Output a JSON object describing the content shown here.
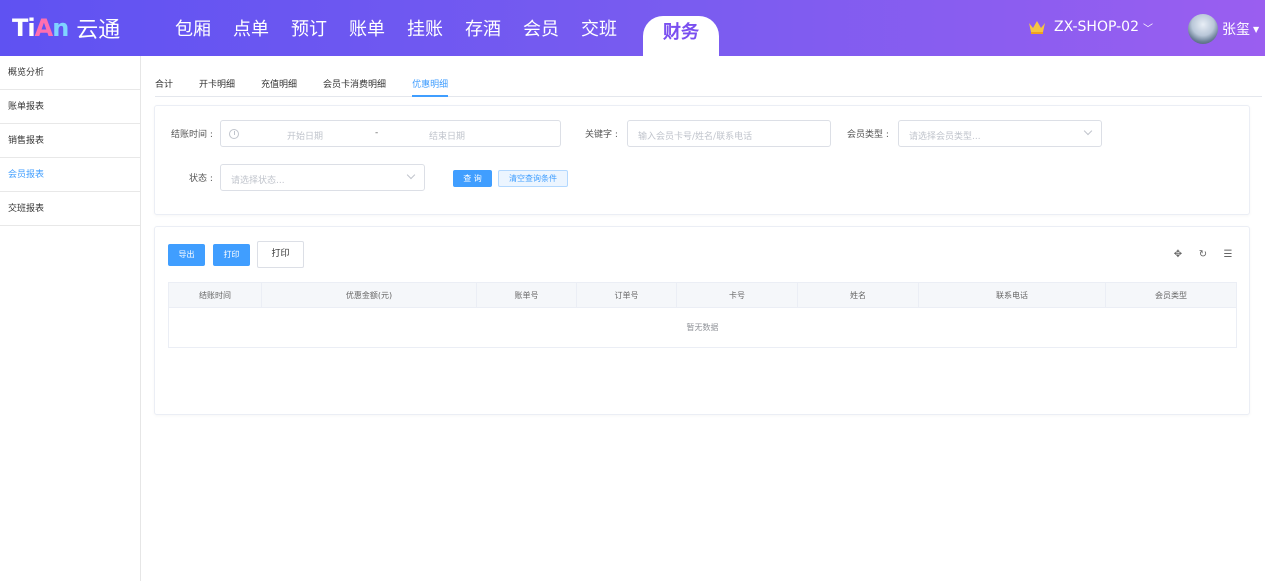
{
  "header": {
    "logo_letters": [
      "Ti",
      "A",
      "n"
    ],
    "logo_text": "云通",
    "nav": [
      "包厢",
      "点单",
      "预订",
      "账单",
      "挂账",
      "存酒",
      "会员",
      "交班",
      "财务"
    ],
    "active_nav": "财务",
    "shop": "ZX-SHOP-02",
    "user": "张玺",
    "colors": {
      "header_start": "#5f52f2",
      "header_end": "#9a5ef0",
      "accent": "#409eff",
      "crown": "#f5c542"
    }
  },
  "sidebar": {
    "items": [
      "概览分析",
      "账单报表",
      "销售报表",
      "会员报表",
      "交班报表"
    ],
    "active": "会员报表"
  },
  "tabs": {
    "items": [
      "合计",
      "开卡明细",
      "充值明细",
      "会员卡消费明细",
      "优惠明细"
    ],
    "active": "优惠明细"
  },
  "filters": {
    "settle_time_label": "结账时间 :",
    "start_date_placeholder": "开始日期",
    "date_separator": "-",
    "end_date_placeholder": "结束日期",
    "keyword_label": "关键字 :",
    "keyword_placeholder": "输入会员卡号/姓名/联系电话",
    "member_type_label": "会员类型 :",
    "member_type_placeholder": "请选择会员类型...",
    "status_label": "状态 :",
    "status_placeholder": "请选择状态...",
    "search_button": "查 询",
    "clear_button": "清空查询条件"
  },
  "table": {
    "export_button": "导出",
    "print_button": "打印",
    "print_button_2": "打印",
    "tool_icons": [
      "move-icon",
      "refresh-icon",
      "columns-icon"
    ],
    "columns": [
      "结账时间",
      "优惠金额(元)",
      "账单号",
      "订单号",
      "卡号",
      "姓名",
      "联系电话",
      "会员类型"
    ],
    "empty_text": "暂无数据"
  }
}
